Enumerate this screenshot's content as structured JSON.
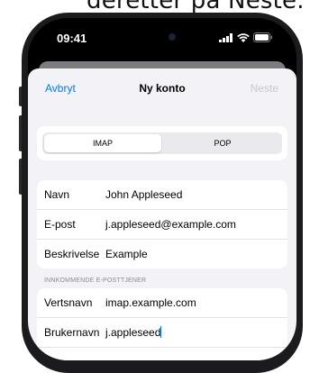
{
  "caption": "deretter på Neste.",
  "status_bar": {
    "time": "09:41"
  },
  "nav": {
    "cancel": "Avbryt",
    "title": "Ny konto",
    "next": "Neste"
  },
  "segmented": {
    "options": [
      "IMAP",
      "POP"
    ],
    "selected": "IMAP"
  },
  "account": {
    "rows": [
      {
        "label": "Navn",
        "value": "John Appleseed"
      },
      {
        "label": "E-post",
        "value": "j.appleseed@example.com"
      },
      {
        "label": "Beskrivelse",
        "value": "Example"
      }
    ]
  },
  "incoming": {
    "header": "INNKOMMENDE E-POSTTJENER",
    "rows": [
      {
        "label": "Vertsnavn",
        "value": "imap.example.com"
      },
      {
        "label": "Brukernavn",
        "value": "j.appleseed"
      }
    ]
  },
  "colors": {
    "accent": "#007aff",
    "disabled": "#c7c7cc",
    "background": "#f2f2f7"
  }
}
